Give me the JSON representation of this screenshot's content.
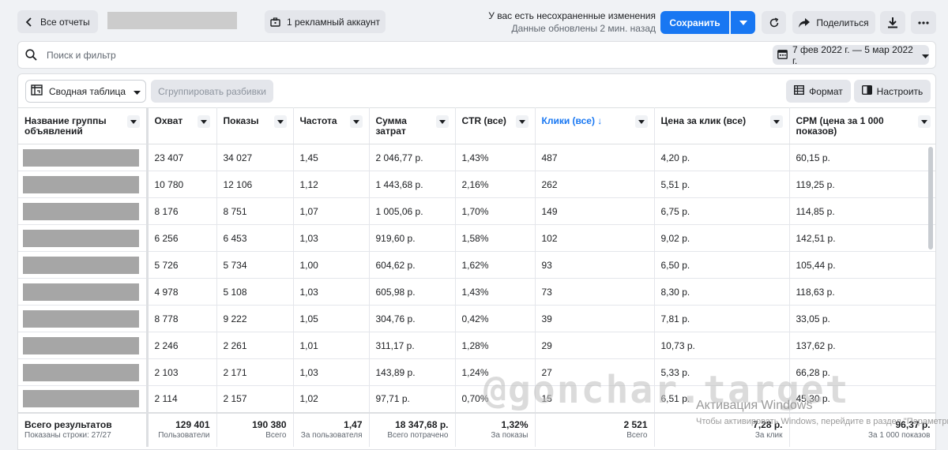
{
  "header": {
    "back_label": "Все отчеты",
    "account_label": "1 рекламный аккаунт",
    "unsaved_title": "У вас есть несохраненные изменения",
    "updated_text": "Данные обновлены 2 мин. назад",
    "save_label": "Сохранить",
    "share_label": "Поделиться"
  },
  "search": {
    "placeholder": "Поиск и фильтр",
    "date_range": "7 фев 2022 г. — 5 мар 2022 г."
  },
  "toolbar": {
    "pivot_label": "Сводная таблица",
    "group_label": "Сгруппировать разбивки",
    "format_label": "Формат",
    "customize_label": "Настроить"
  },
  "table": {
    "columns": [
      "Название группы объявлений",
      "Охват",
      "Показы",
      "Частота",
      "Сумма затрат",
      "CTR (все)",
      "Клики (все) ↓",
      "Цена за клик (все)",
      "CPM (цена за 1 000 показов)"
    ],
    "rows": [
      [
        "23 407",
        "34 027",
        "1,45",
        "2 046,77 р.",
        "1,43%",
        "487",
        "4,20 р.",
        "60,15 р."
      ],
      [
        "10 780",
        "12 106",
        "1,12",
        "1 443,68 р.",
        "2,16%",
        "262",
        "5,51 р.",
        "119,25 р."
      ],
      [
        "8 176",
        "8 751",
        "1,07",
        "1 005,06 р.",
        "1,70%",
        "149",
        "6,75 р.",
        "114,85 р."
      ],
      [
        "6 256",
        "6 453",
        "1,03",
        "919,60 р.",
        "1,58%",
        "102",
        "9,02 р.",
        "142,51 р."
      ],
      [
        "5 726",
        "5 734",
        "1,00",
        "604,62 р.",
        "1,62%",
        "93",
        "6,50 р.",
        "105,44 р."
      ],
      [
        "4 978",
        "5 108",
        "1,03",
        "605,98 р.",
        "1,43%",
        "73",
        "8,30 р.",
        "118,63 р."
      ],
      [
        "8 778",
        "9 222",
        "1,05",
        "304,76 р.",
        "0,42%",
        "39",
        "7,81 р.",
        "33,05 р."
      ],
      [
        "2 246",
        "2 261",
        "1,01",
        "311,17 р.",
        "1,28%",
        "29",
        "10,73 р.",
        "137,62 р."
      ],
      [
        "2 103",
        "2 171",
        "1,03",
        "143,89 р.",
        "1,24%",
        "27",
        "5,33 р.",
        "66,28 р."
      ],
      [
        "2 114",
        "2 157",
        "1,02",
        "97,71 р.",
        "0,70%",
        "15",
        "6,51 р.",
        "45,30 р."
      ]
    ],
    "totals_label": "Всего результатов",
    "rows_shown": "Показаны строки: 27/27",
    "totals": [
      {
        "value": "129 401",
        "sub": "Пользователи"
      },
      {
        "value": "190 380",
        "sub": "Всего"
      },
      {
        "value": "1,47",
        "sub": "За пользователя"
      },
      {
        "value": "18 347,68 р.",
        "sub": "Всего потрачено"
      },
      {
        "value": "1,32%",
        "sub": "За показы"
      },
      {
        "value": "2 521",
        "sub": "Всего"
      },
      {
        "value": "7,28 р.",
        "sub": "За клик"
      },
      {
        "value": "96,37 р.",
        "sub": "За 1 000 показов"
      }
    ]
  },
  "overlay": {
    "watermark": "@gonchar.target",
    "activation_title": "Активация Windows",
    "activation_text": "Чтобы активировать Windows, перейдите в раздел \"Параметры\"."
  },
  "colors": {
    "accent": "#1877f2",
    "button_bg": "#e4e6eb"
  }
}
